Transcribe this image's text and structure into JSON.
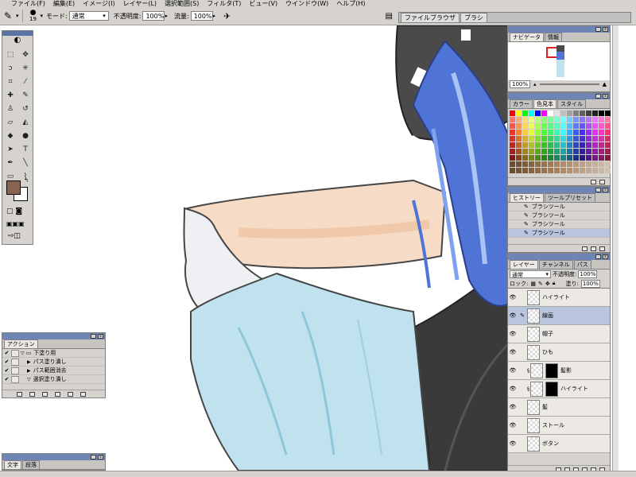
{
  "menubar": [
    "ファイル(F)",
    "編集(E)",
    "イメージ(I)",
    "レイヤー(L)",
    "選択範囲(S)",
    "フィルタ(T)",
    "ビュー(V)",
    "ウインドウ(W)",
    "ヘルプ(H)"
  ],
  "options": {
    "brush_size": "19",
    "mode_label": "モード:",
    "mode_value": "通常",
    "opacity_label": "不透明度:",
    "opacity_value": "100%",
    "flow_label": "流量:",
    "flow_value": "100%"
  },
  "palette_well": [
    "ファイルブラウザ",
    "ブラシ"
  ],
  "navigator": {
    "tabs": [
      "ナビゲータ",
      "情報"
    ],
    "zoom": "100%"
  },
  "swatches": {
    "tabs": [
      "カラー",
      "色見本",
      "スタイル"
    ]
  },
  "history": {
    "tabs": [
      "ヒストリー",
      "ツールプリセット"
    ],
    "items": [
      "ブラシツール",
      "ブラシツール",
      "ブラシツール",
      "ブラシツール"
    ]
  },
  "layers": {
    "tabs": [
      "レイヤー",
      "チャンネル",
      "パス"
    ],
    "blend": "通常",
    "opacity_label": "不透明度:",
    "opacity_value": "100%",
    "lock_label": "ロック:",
    "fill_label": "塗り:",
    "fill_value": "100%",
    "items": [
      {
        "name": "ハイライト",
        "selected": false,
        "mask": false
      },
      {
        "name": "線画",
        "selected": true,
        "mask": false
      },
      {
        "name": "帽子",
        "selected": false,
        "mask": false
      },
      {
        "name": "ひも",
        "selected": false,
        "mask": false
      },
      {
        "name": "髪影",
        "selected": false,
        "mask": true
      },
      {
        "name": "ハイライト",
        "selected": false,
        "mask": true
      },
      {
        "name": "髪",
        "selected": false,
        "mask": false
      },
      {
        "name": "ストール",
        "selected": false,
        "mask": false
      },
      {
        "name": "ボタン",
        "selected": false,
        "mask": false
      }
    ]
  },
  "actions": {
    "tabs": [
      "アクション"
    ],
    "set_name": "下塗り用",
    "items": [
      "パス塗り潰し",
      "パス範囲消去",
      "選択塗り潰し"
    ]
  },
  "character": {
    "tabs": [
      "文字",
      "段落"
    ]
  },
  "colors": {
    "foreground": "#8a6450",
    "background": "#ffffff",
    "title_bar": "#6f85b5"
  }
}
